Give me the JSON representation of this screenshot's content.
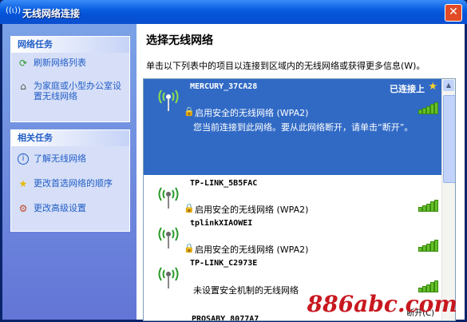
{
  "window": {
    "title": "无线网络连接",
    "title_icon": "wifi-icon"
  },
  "left": {
    "network_tasks": {
      "header": "网络任务",
      "items": [
        {
          "label": "刷新网络列表",
          "icon": "refresh-icon"
        },
        {
          "label": "为家庭或小型办公室设置无线网络",
          "icon": "setup-icon"
        }
      ]
    },
    "related_tasks": {
      "header": "相关任务",
      "items": [
        {
          "label": "了解无线网络",
          "icon": "info-icon"
        },
        {
          "label": "更改首选网络的顺序",
          "icon": "star-icon"
        },
        {
          "label": "更改高级设置",
          "icon": "settings-icon"
        }
      ]
    }
  },
  "main": {
    "title": "选择无线网络",
    "description": "单击以下列表中的项目以连接到区域内的无线网络或获得更多信息(W)。",
    "networks": [
      {
        "name": "MERCURY_37CA28",
        "security": "启用安全的无线网络 (WPA2)",
        "status": "已连接上",
        "message": "您当前连接到此网络。要从此网络断开，请单击“断开”。",
        "selected": true,
        "signal": 5
      },
      {
        "name": "TP-LINK_5B5FAC",
        "security": "启用安全的无线网络 (WPA2)",
        "signal": 5
      },
      {
        "name": "tplinkXIAOWEI",
        "security": "启用安全的无线网络 (WPA2)",
        "signal": 5
      },
      {
        "name": "TP-LINK_C2973E",
        "security": "未设置安全机制的无线网络",
        "signal": 5
      }
    ],
    "partial_next_name": "PROSABY 8077A7",
    "connect_button": "断开(C)"
  },
  "watermark": "886abc.com",
  "colors": {
    "titlebar": "#0553d8",
    "selected_row": "#316ac5",
    "link": "#215dc6",
    "close": "#e24b26"
  }
}
